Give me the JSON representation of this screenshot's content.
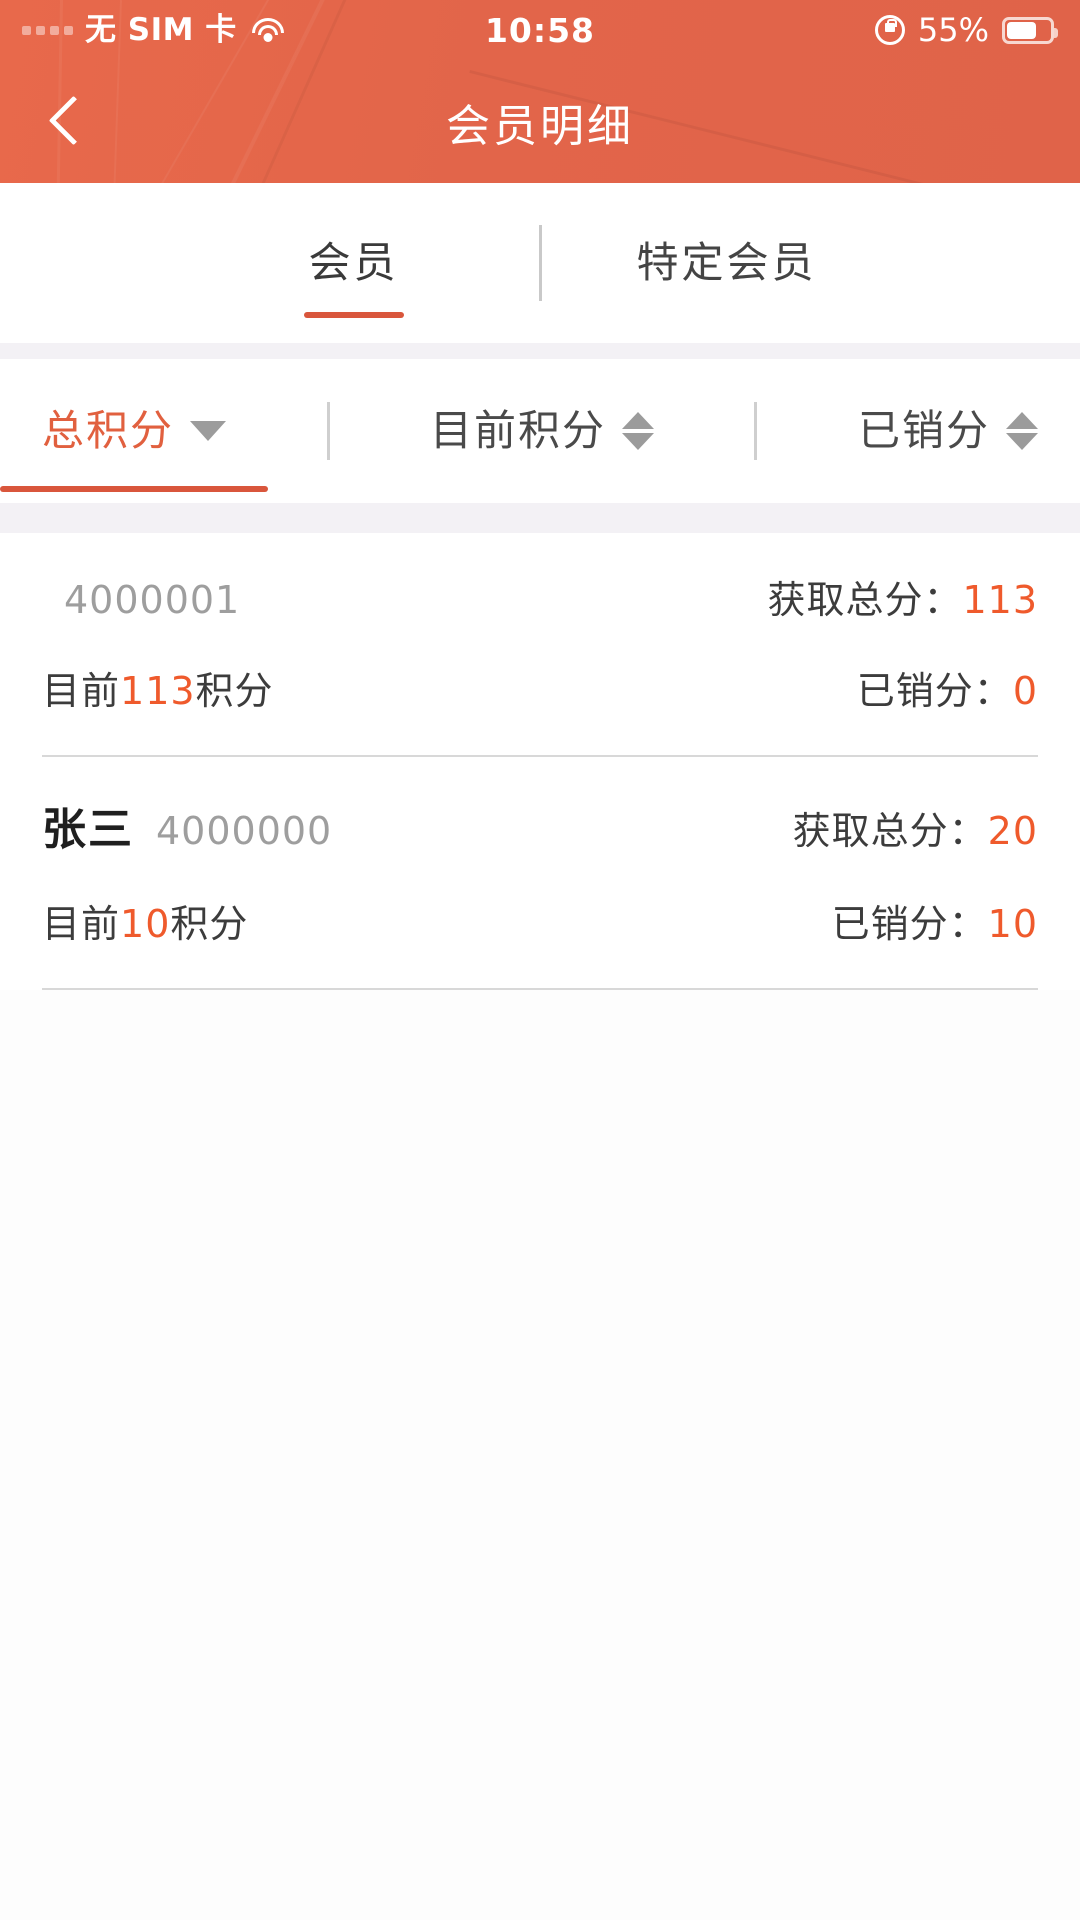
{
  "status_bar": {
    "signal_icon": "signal-dots-icon",
    "carrier": "无 SIM 卡",
    "wifi_icon": "wifi-icon",
    "time": "10:58",
    "rotation_lock_icon": "rotation-lock-icon",
    "battery_percent": "55%",
    "battery_icon": "battery-icon"
  },
  "header": {
    "back_icon": "back-chevron-icon",
    "title": "会员明细"
  },
  "tabs": [
    {
      "label": "会员",
      "active": true
    },
    {
      "label": "特定会员",
      "active": false
    }
  ],
  "sort_bar": [
    {
      "label": "总积分",
      "icon": "caret-down-icon",
      "active": true
    },
    {
      "label": "目前积分",
      "icon": "sort-updown-icon",
      "active": false
    },
    {
      "label": "已销分",
      "icon": "sort-updown-icon",
      "active": false
    }
  ],
  "list": {
    "labels": {
      "total_earned": "获取总分：",
      "current_prefix": "目前",
      "current_suffix": "积分",
      "redeemed": "已销分："
    },
    "rows": [
      {
        "name": "",
        "code": "4000001",
        "total_earned": "113",
        "current": "113",
        "redeemed": "0"
      },
      {
        "name": "张三",
        "code": "4000000",
        "total_earned": "20",
        "current": "10",
        "redeemed": "10"
      }
    ]
  },
  "colors": {
    "brand_orange": "#e2654a",
    "accent_underline": "#d9563c",
    "value_orange": "#ef5a2c",
    "band_gray": "#f3f1f5"
  }
}
